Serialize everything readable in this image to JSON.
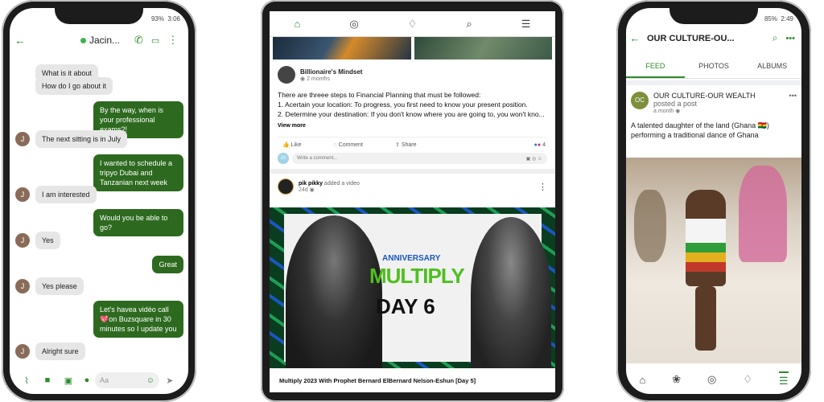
{
  "phone_left": {
    "status": {
      "battery": "93%",
      "time": "3:06"
    },
    "header": {
      "contact": "Jacin..."
    },
    "messages": [
      {
        "text": "What is it about",
        "dir": "in",
        "avatar": false
      },
      {
        "text": "How do I go about it",
        "dir": "in",
        "avatar": false
      },
      {
        "text": "By the way, when is your professional exams?!",
        "dir": "out"
      },
      {
        "text": "The next sitting is in July",
        "dir": "in",
        "avatar": true
      },
      {
        "text": "I wanted to schedule a tripyo Dubai and Tanzanian next week",
        "dir": "out"
      },
      {
        "text": "I am interested",
        "dir": "in",
        "avatar": true
      },
      {
        "text": "Would you be able to go?",
        "dir": "out"
      },
      {
        "text": "Yes",
        "dir": "in",
        "avatar": true
      },
      {
        "text": "Great",
        "dir": "out"
      },
      {
        "text": "Yes please",
        "dir": "in",
        "avatar": true
      },
      {
        "text": "Let's havea vidéo call 💖on Buzsquare in 30 minutes so I update you",
        "dir": "out"
      },
      {
        "text": "Alright sure",
        "dir": "in",
        "avatar": true
      }
    ],
    "avatar_letter": "J",
    "composer": {
      "placeholder": "Aa"
    }
  },
  "tablet": {
    "post1": {
      "author": "Billionaire's Mindset",
      "time": "2 months",
      "body": "There are threee steps to Financial Planning that must be followed:\n1. Acertain your location: To progress, you first need to know your present position.\n2. Determine your destination: If you don't know where you are going to, you won't kno...",
      "view_more": "View more",
      "like": "Like",
      "comment": "Comment",
      "share": "Share",
      "reactions": "4",
      "commenter_initials": "JV",
      "comment_placeholder": "Write a comment..."
    },
    "post2": {
      "author": "pik pikky",
      "action": "added a video",
      "time": "24d",
      "banner_small": "Anniversary",
      "banner_title": "MULTIPLY",
      "banner_day": "DAY 6",
      "caption": "Multiply 2023 With Prophet Bernard ElBernard Nelson-Eshun [Day 5]"
    }
  },
  "phone_right": {
    "status": {
      "battery": "85%",
      "time": "2:49"
    },
    "header": {
      "title": "OUR CULTURE-OU..."
    },
    "tabs": [
      "FEED",
      "PHOTOS",
      "ALBUMS"
    ],
    "post": {
      "avatar": "OC",
      "author": "OUR CULTURE-OUR WEALTH",
      "action": "posted a post",
      "time": "a month",
      "body": "A talented daughter of the land (Ghana 🇬🇭) performing a traditional dance of Ghana"
    }
  },
  "colors": {
    "accent": "#2e8b2e",
    "bubble_out": "#2d6a1f"
  }
}
